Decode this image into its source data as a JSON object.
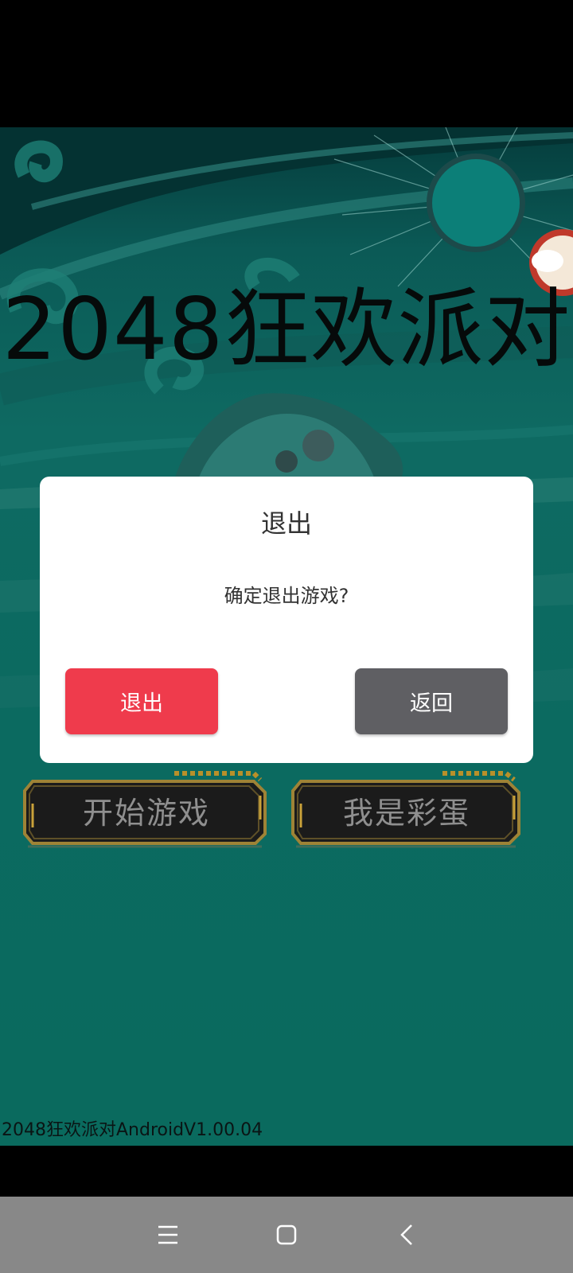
{
  "game": {
    "title": "2048狂欢派对",
    "start_button": "开始游戏",
    "easter_egg_button": "我是彩蛋",
    "version": "2048狂欢派对AndroidV1.00.04"
  },
  "dialog": {
    "title": "退出",
    "message": "确定退出游戏?",
    "exit_button": "退出",
    "back_button": "返回",
    "exit_color": "#ef3b4c",
    "back_color": "#5f5f63"
  },
  "nav": {
    "icons": [
      "menu-icon",
      "home-icon",
      "back-icon"
    ]
  },
  "colors": {
    "background": "#0e6a62",
    "nav_bar": "#888888"
  }
}
